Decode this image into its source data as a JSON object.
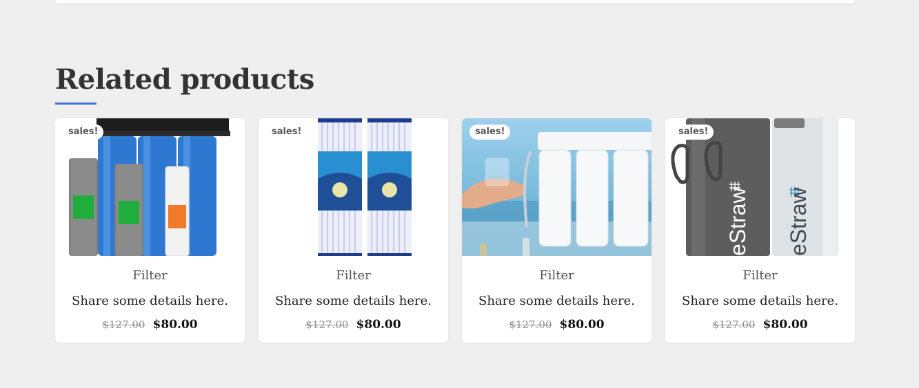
{
  "section": {
    "title": "Related products",
    "accent_color": "#3f72dd"
  },
  "products": [
    {
      "badge": "sales!",
      "category": "Filter",
      "details": "Share some details here.",
      "regular_price": "$127.00",
      "sale_price": "$80.00",
      "image": "whole-house-filter-system"
    },
    {
      "badge": "sales!",
      "category": "Filter",
      "details": "Share some details here.",
      "regular_price": "$127.00",
      "sale_price": "$80.00",
      "image": "pleated-filter-cartridges"
    },
    {
      "badge": "sales!",
      "category": "Filter",
      "details": "Share some details here.",
      "regular_price": "$127.00",
      "sale_price": "$80.00",
      "image": "reverse-osmosis-system"
    },
    {
      "badge": "sales!",
      "category": "Filter",
      "details": "Share some details here.",
      "regular_price": "$127.00",
      "sale_price": "$80.00",
      "image": "lifestraw-bottles",
      "image_text": "eStraw"
    }
  ]
}
